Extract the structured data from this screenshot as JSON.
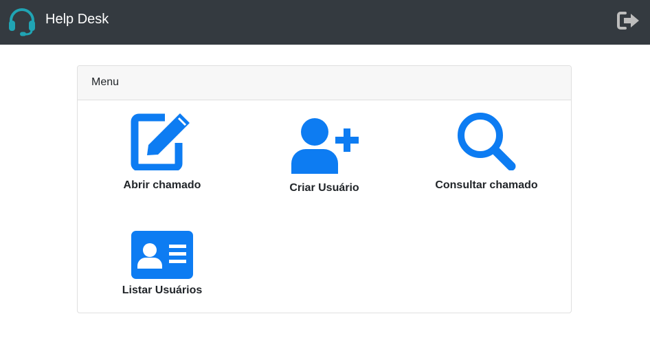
{
  "navbar": {
    "brand_title": "Help Desk",
    "logo_icon": "headset-icon",
    "logout_icon": "sign-out-icon"
  },
  "card": {
    "header": "Menu"
  },
  "menu": {
    "items": [
      {
        "label": "Abrir chamado",
        "icon": "edit-icon"
      },
      {
        "label": "Criar Usuário",
        "icon": "user-plus-icon"
      },
      {
        "label": "Consultar chamado",
        "icon": "search-icon"
      },
      {
        "label": "Listar Usuários",
        "icon": "id-card-icon"
      }
    ]
  },
  "colors": {
    "navbar_bg": "#343a40",
    "logo_teal": "#20a4b4",
    "icon_blue": "#0d7cf2",
    "logout_gray": "#bdbdbd"
  }
}
